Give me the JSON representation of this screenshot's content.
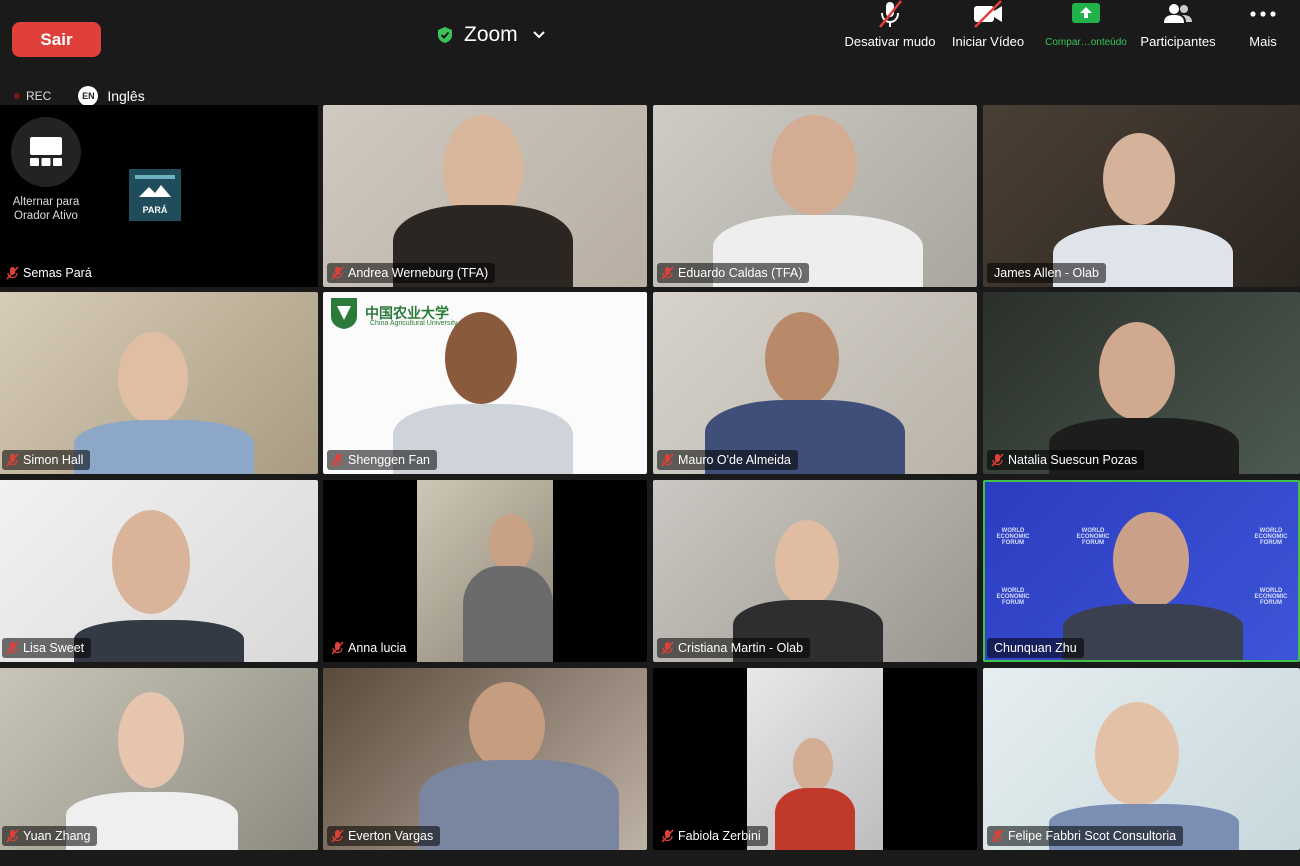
{
  "header": {
    "leave_label": "Sair",
    "meeting_title": "Zoom",
    "tools": [
      {
        "label": "Desativar mudo",
        "icon": "microphone-muted-icon"
      },
      {
        "label": "Iniciar Vídeo",
        "icon": "video-off-icon"
      },
      {
        "label": "Compar…onteúdo",
        "icon": "share-screen-icon"
      },
      {
        "label": "Participantes",
        "icon": "participants-icon"
      },
      {
        "label": "Mais",
        "icon": "more-icon"
      }
    ]
  },
  "status": {
    "rec_label": "REC",
    "lang_code": "EN",
    "lang_label": "Inglês"
  },
  "active_speaker_switch_label": "Alternar para Orador Ativo",
  "logo_text": "PARÁ",
  "cau_logo_text": "中国农业大学",
  "cau_logo_sub": "China Agricultural University",
  "wef_text": "WORLD ECONOMIC FORUM",
  "participants": [
    {
      "name": "Semas Pará",
      "muted": true
    },
    {
      "name": "Andrea Werneburg (TFA)",
      "muted": true
    },
    {
      "name": "Eduardo Caldas (TFA)",
      "muted": true
    },
    {
      "name": "James Allen - Olab",
      "muted": false
    },
    {
      "name": "Simon Hall",
      "muted": true
    },
    {
      "name": "Shenggen Fan",
      "muted": true
    },
    {
      "name": "Mauro O'de Almeida",
      "muted": true
    },
    {
      "name": "Natalia Suescun Pozas",
      "muted": true
    },
    {
      "name": "Lisa Sweet",
      "muted": true
    },
    {
      "name": "Anna lucia",
      "muted": true
    },
    {
      "name": "Cristiana Martin - Olab",
      "muted": true
    },
    {
      "name": "Chunquan Zhu",
      "muted": false,
      "active": true
    },
    {
      "name": "Yuan Zhang",
      "muted": true
    },
    {
      "name": "Everton Vargas",
      "muted": true
    },
    {
      "name": "Fabiola Zerbini",
      "muted": true
    },
    {
      "name": "Felipe Fabbri Scot Consultoria",
      "muted": true
    }
  ],
  "colors": {
    "leave": "#e0403a",
    "active_border": "#3fbf4c",
    "muted_mic": "#e0403a",
    "share_green": "#22b24c"
  }
}
